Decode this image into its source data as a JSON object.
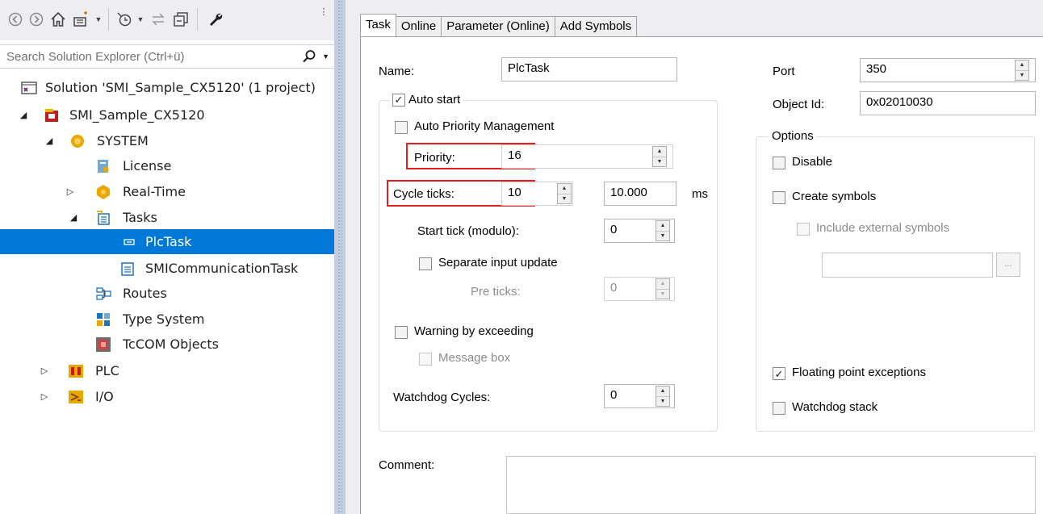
{
  "explorer": {
    "search": {
      "placeholder": "Search Solution Explorer (Ctrl+ü)"
    },
    "tree": [
      {
        "id": "solution",
        "label": "Solution 'SMI_Sample_CX5120' (1 project)",
        "icon": "solution-icon"
      },
      {
        "id": "project",
        "label": "SMI_Sample_CX5120",
        "icon": "project-icon",
        "expanded": true
      },
      {
        "id": "system",
        "label": "SYSTEM",
        "icon": "system-icon",
        "expanded": true
      },
      {
        "id": "license",
        "label": "License",
        "icon": "license-icon"
      },
      {
        "id": "realtime",
        "label": "Real-Time",
        "icon": "realtime-icon",
        "expanded": false
      },
      {
        "id": "tasks",
        "label": "Tasks",
        "icon": "tasks-icon",
        "expanded": true
      },
      {
        "id": "plctask",
        "label": "PlcTask",
        "icon": "plc-task-icon",
        "selected": true
      },
      {
        "id": "smicomm",
        "label": "SMICommunicationTask",
        "icon": "task-icon"
      },
      {
        "id": "routes",
        "label": "Routes",
        "icon": "routes-icon"
      },
      {
        "id": "typesystem",
        "label": "Type System",
        "icon": "type-system-icon"
      },
      {
        "id": "tccom",
        "label": "TcCOM Objects",
        "icon": "tccom-icon"
      },
      {
        "id": "plc",
        "label": "PLC",
        "icon": "plc-icon",
        "expanded": false
      },
      {
        "id": "io",
        "label": "I/O",
        "icon": "io-icon",
        "expanded": false
      }
    ]
  },
  "tabs": [
    {
      "label": "Task",
      "active": true
    },
    {
      "label": "Online",
      "active": false
    },
    {
      "label": "Parameter (Online)",
      "active": false
    },
    {
      "label": "Add Symbols",
      "active": false
    }
  ],
  "task": {
    "name_label": "Name:",
    "name_value": "PlcTask",
    "auto_start": {
      "label": "Auto start",
      "checked": true
    },
    "auto_priority": {
      "label": "Auto Priority Management",
      "checked": false
    },
    "priority": {
      "label": "Priority:",
      "value": "16"
    },
    "cycle_ticks": {
      "label": "Cycle ticks:",
      "value": "10",
      "ms_value": "10.000",
      "ms_unit": "ms"
    },
    "start_tick": {
      "label": "Start tick (modulo):",
      "value": "0"
    },
    "separate_input": {
      "label": "Separate input update",
      "checked": false
    },
    "pre_ticks": {
      "label": "Pre ticks:",
      "value": "0"
    },
    "warning": {
      "label": "Warning by exceeding",
      "checked": false
    },
    "message_box": {
      "label": "Message box",
      "checked": false
    },
    "watchdog_cycles": {
      "label": "Watchdog Cycles:",
      "value": "0"
    },
    "port": {
      "label": "Port",
      "value": "350"
    },
    "object_id": {
      "label": "Object Id:",
      "value": "0x02010030"
    },
    "options": {
      "title": "Options",
      "disable": {
        "label": "Disable",
        "checked": false
      },
      "create_symbols": {
        "label": "Create symbols",
        "checked": false
      },
      "include_external": {
        "label": "Include external symbols",
        "checked": false
      },
      "browse_button": "...",
      "floating_point": {
        "label": "Floating point exceptions",
        "checked": true
      },
      "watchdog_stack": {
        "label": "Watchdog stack",
        "checked": false
      }
    },
    "comment_label": "Comment:"
  },
  "colors": {
    "selection": "#0078d7",
    "highlight": "#e02020"
  }
}
